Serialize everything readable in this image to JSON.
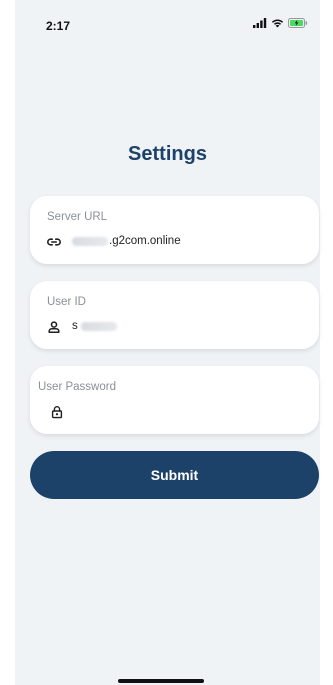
{
  "status_bar": {
    "time": "2:17"
  },
  "page": {
    "title": "Settings"
  },
  "server_url": {
    "label": "Server URL",
    "value_suffix": ".g2com.online",
    "icon": "link-icon"
  },
  "user_id": {
    "label": "User ID",
    "value_prefix": "s",
    "icon": "person-icon"
  },
  "user_password": {
    "label": "User Password",
    "icon": "lock-icon"
  },
  "submit": {
    "label": "Submit"
  },
  "colors": {
    "accent": "#1d4269",
    "background": "#eff3f6",
    "card": "#ffffff",
    "label": "#8a8f97"
  }
}
